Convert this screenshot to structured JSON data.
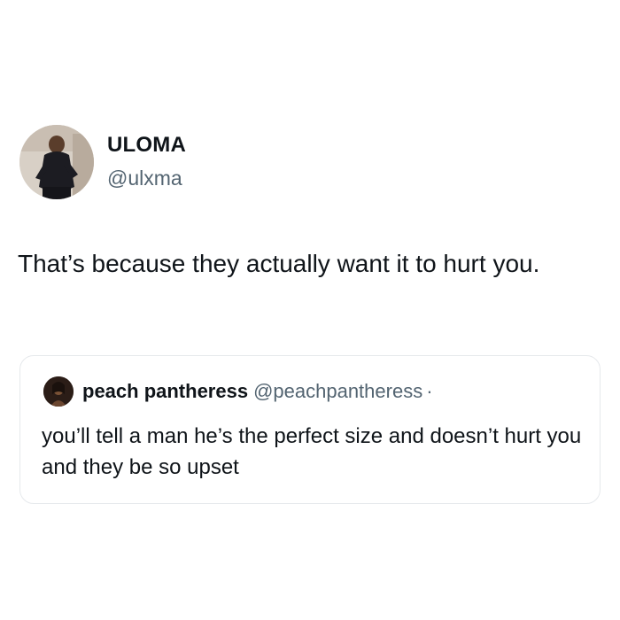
{
  "tweet": {
    "author": {
      "display_name": "ULOMA",
      "handle": "@ulxma",
      "avatar_icon": "profile-photo"
    },
    "text": "That’s because they actually want it to hurt you.",
    "quoted_tweet": {
      "author": {
        "display_name": "peach pantheress",
        "handle": "@peachpantheress",
        "separator": "·",
        "avatar_icon": "profile-photo"
      },
      "text": "you’ll tell a man he’s the perfect size and doesn’t hurt you and they be so upset"
    }
  },
  "colors": {
    "text_primary": "#0f1419",
    "text_secondary": "#536471",
    "card_border": "#e6e9ec",
    "background": "#ffffff"
  }
}
